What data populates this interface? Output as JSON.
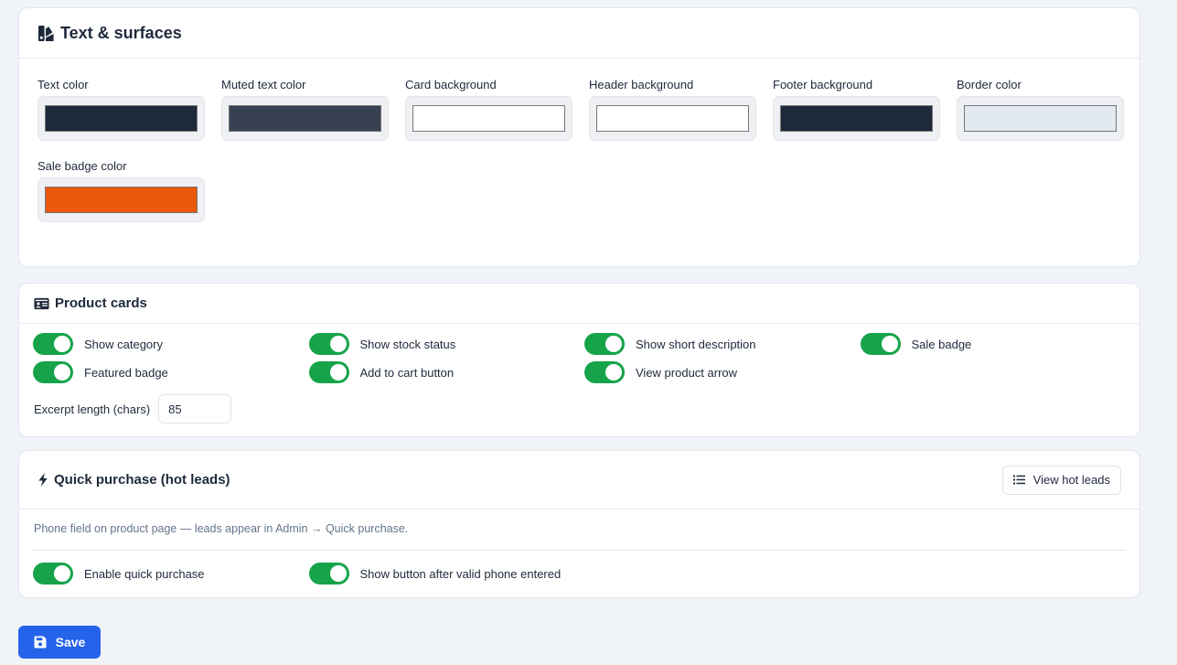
{
  "colors": {
    "accent": "#16a34a",
    "primary": "#2563eb",
    "page_background": "#f0f3f8"
  },
  "text_surfaces": {
    "title": "Text & surfaces",
    "icon": "swatchbook-icon",
    "fields": [
      {
        "label": "Text color",
        "value": "#1e293b"
      },
      {
        "label": "Muted text color",
        "value": "#374151"
      },
      {
        "label": "Card background",
        "value": "#ffffff"
      },
      {
        "label": "Header background",
        "value": "#ffffff"
      },
      {
        "label": "Footer background",
        "value": "#1e293b"
      },
      {
        "label": "Border color",
        "value": "#e2e8f0"
      },
      {
        "label": "Sale badge color",
        "value": "#ea580c"
      }
    ]
  },
  "product_cards": {
    "title": "Product cards",
    "icon": "id-card-icon",
    "toggles": [
      {
        "label": "Show category",
        "on": true
      },
      {
        "label": "Show stock status",
        "on": true
      },
      {
        "label": "Show short description",
        "on": true
      },
      {
        "label": "Sale badge",
        "on": true
      },
      {
        "label": "Featured badge",
        "on": true
      },
      {
        "label": "Add to cart button",
        "on": true
      },
      {
        "label": "View product arrow",
        "on": true
      }
    ],
    "excerpt_label": "Excerpt length (chars)",
    "excerpt_value": "85"
  },
  "quick_purchase": {
    "title": "Quick purchase (hot leads)",
    "icon": "bolt-icon",
    "view_button_label": "View hot leads",
    "view_button_icon": "list-icon",
    "description": "Phone field on product page — leads appear in Admin → Quick purchase.",
    "toggles": [
      {
        "label": "Enable quick purchase",
        "on": true
      },
      {
        "label": "Show button after valid phone entered",
        "on": true
      }
    ]
  },
  "save": {
    "label": "Save",
    "icon": "floppy-disk-icon"
  }
}
